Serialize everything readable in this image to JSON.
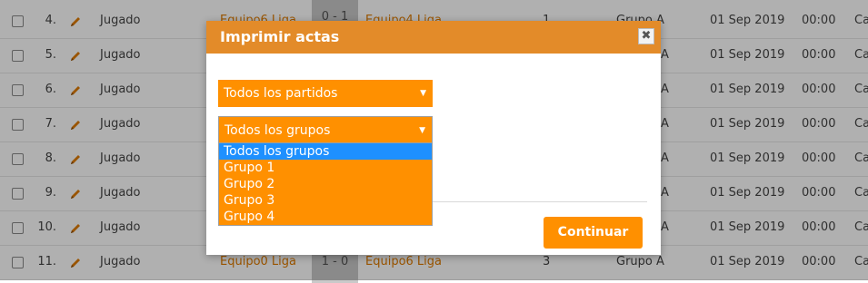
{
  "table": {
    "rows": [
      {
        "num": "4.",
        "status": "Jugado",
        "home": "Equipo6 Liga",
        "score": "0 - 1",
        "away": "Equipo4 Liga",
        "round": "1",
        "group": "Grupo A",
        "date": "01 Sep 2019",
        "time": "00:00",
        "extra": "Ca"
      },
      {
        "num": "5.",
        "status": "Jugado",
        "home": "",
        "score": "",
        "away": "",
        "round": "",
        "group": "",
        "date": "01 Sep 2019",
        "time": "00:00",
        "extra": "Ca"
      },
      {
        "num": "6.",
        "status": "Jugado",
        "home": "",
        "score": "",
        "away": "",
        "round": "",
        "group": "",
        "date": "01 Sep 2019",
        "time": "00:00",
        "extra": "Ca"
      },
      {
        "num": "7.",
        "status": "Jugado",
        "home": "",
        "score": "",
        "away": "",
        "round": "",
        "group": "",
        "date": "01 Sep 2019",
        "time": "00:00",
        "extra": "Ca"
      },
      {
        "num": "8.",
        "status": "Jugado",
        "home": "",
        "score": "",
        "away": "",
        "round": "",
        "group": "",
        "date": "01 Sep 2019",
        "time": "00:00",
        "extra": "Ca"
      },
      {
        "num": "9.",
        "status": "Jugado",
        "home": "",
        "score": "",
        "away": "",
        "round": "",
        "group": "",
        "date": "01 Sep 2019",
        "time": "00:00",
        "extra": "Ca"
      },
      {
        "num": "10.",
        "status": "Jugado",
        "home": "",
        "score": "",
        "away": "",
        "round": "",
        "group": "",
        "date": "01 Sep 2019",
        "time": "00:00",
        "extra": "Ca"
      },
      {
        "num": "11.",
        "status": "Jugado",
        "home": "Equipo0 Liga",
        "score": "1 - 0",
        "away": "Equipo6 Liga",
        "round": "3",
        "group": "Grupo A",
        "date": "01 Sep 2019",
        "time": "00:00",
        "extra": "Ca"
      }
    ],
    "group_partial": "A",
    "icons": {
      "edit": "pencil-icon",
      "checkbox": "checkbox"
    }
  },
  "modal": {
    "title": "Imprimir actas",
    "close_label": "✖",
    "matches_select": {
      "value": "Todos los partidos"
    },
    "groups_select": {
      "value": "Todos los grupos",
      "options": [
        "Todos los grupos",
        "Grupo 1",
        "Grupo 2",
        "Grupo 3",
        "Grupo 4"
      ],
      "selected_index": 0
    },
    "continue_label": "Continuar"
  },
  "colors": {
    "accent_orange": "#ff9000",
    "header_orange": "#e38b29",
    "link_orange": "#e07b00",
    "option_highlight": "#1e90ff"
  }
}
